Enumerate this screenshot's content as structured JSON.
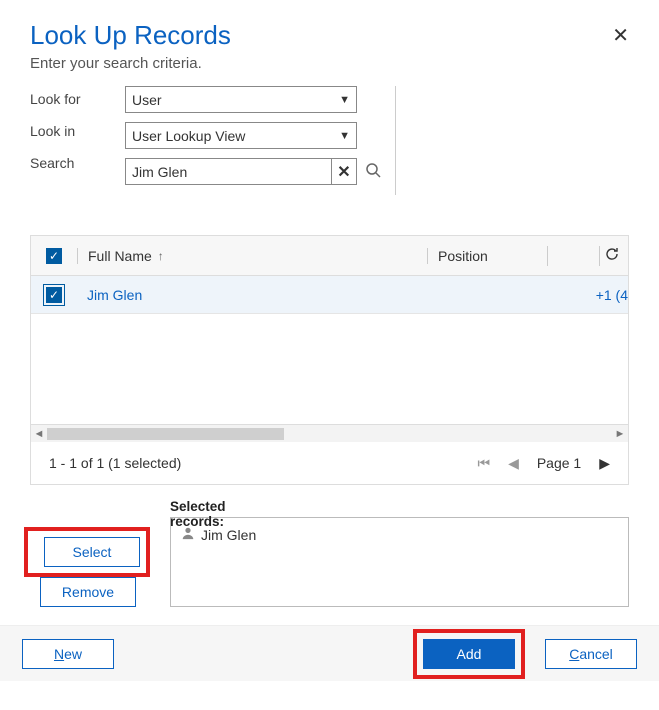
{
  "header": {
    "title": "Look Up Records",
    "subtitle": "Enter your search criteria."
  },
  "form": {
    "look_for_label": "Look for",
    "look_in_label": "Look in",
    "search_label": "Search",
    "look_for_value": "User",
    "look_in_value": "User Lookup View",
    "search_value": "Jim Glen"
  },
  "grid": {
    "columns": {
      "full_name": "Full Name",
      "position": "Position"
    },
    "rows": [
      {
        "full_name": "Jim Glen",
        "position": "",
        "phone": "+1 (4"
      }
    ],
    "pager_status": "1 - 1 of 1 (1 selected)",
    "page_label": "Page 1"
  },
  "selected": {
    "label": "Selected records:",
    "select_btn": "Select",
    "remove_btn": "Remove",
    "items": [
      "Jim Glen"
    ]
  },
  "footer": {
    "new_btn_prefix": "N",
    "new_btn_rest": "ew",
    "add_btn": "Add",
    "cancel_btn_prefix": "C",
    "cancel_btn_rest": "ancel"
  }
}
